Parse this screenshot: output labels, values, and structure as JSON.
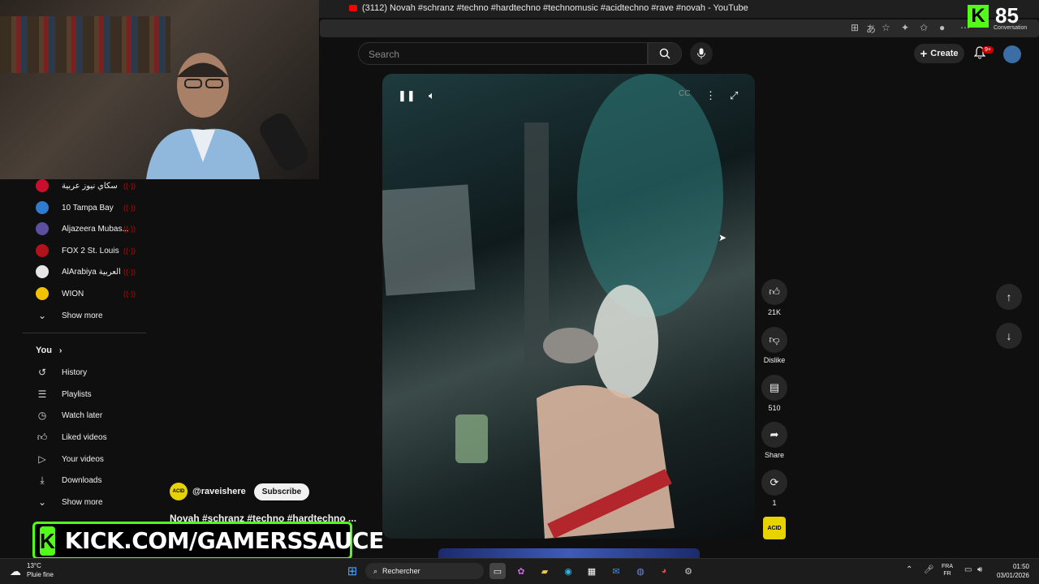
{
  "browser": {
    "tab_title": "(3112) Novah #schranz #techno #hardtechno #technomusic #acidtechno #rave #novah - YouTube"
  },
  "header": {
    "search_placeholder": "Search",
    "create_label": "Create",
    "notif_badge": "9+"
  },
  "overlay": {
    "kick_count": "85",
    "kick_conversation": "Conversation",
    "kick_logo": "K",
    "kick_banner_text": "KICK.COM/GAMERSSAUCE"
  },
  "sidebar": {
    "subscriptions": [
      {
        "label": "سكاي نيوز عربية",
        "color": "#c8102e"
      },
      {
        "label": "10 Tampa Bay",
        "color": "#2e7bcf"
      },
      {
        "label": "Aljazeera Mubas...",
        "color": "#5b4fa0"
      },
      {
        "label": "FOX 2 St. Louis",
        "color": "#b3121b"
      },
      {
        "label": "AlArabiya العربية",
        "color": "#e6e6e6"
      },
      {
        "label": "WION",
        "color": "#f2c200"
      }
    ],
    "live_marker": "((·))",
    "show_more_1": "Show more",
    "you_label": "You",
    "you_items": [
      {
        "label": "History",
        "icon": "history-icon"
      },
      {
        "label": "Playlists",
        "icon": "playlists-icon"
      },
      {
        "label": "Watch later",
        "icon": "clock-icon"
      },
      {
        "label": "Liked videos",
        "icon": "thumbs-up-icon"
      },
      {
        "label": "Your videos",
        "icon": "video-icon"
      },
      {
        "label": "Downloads",
        "icon": "download-icon"
      }
    ],
    "show_more_2": "Show more"
  },
  "video": {
    "channel": "@raveishere",
    "channel_avatar_text": "ACID",
    "subscribe_label": "Subscribe",
    "title": "Novah #schranz #techno #hardtechno ..."
  },
  "actions": {
    "likes": "21K",
    "dislike_label": "Dislike",
    "comments": "510",
    "share_label": "Share",
    "remix_count": "1",
    "sound_thumb_text": "ACID"
  },
  "taskbar": {
    "weather_temp": "13°C",
    "weather_desc": "Pluie fine",
    "search_label": "Rechercher",
    "lang_1": "FRA",
    "lang_2": "FR",
    "time": "01:50",
    "date": "03/01/2026"
  },
  "colors": {
    "background": "#0f0f0f",
    "kick_green": "#53fc18",
    "live_red": "#cc0000",
    "acid_yellow": "#e6d300"
  }
}
